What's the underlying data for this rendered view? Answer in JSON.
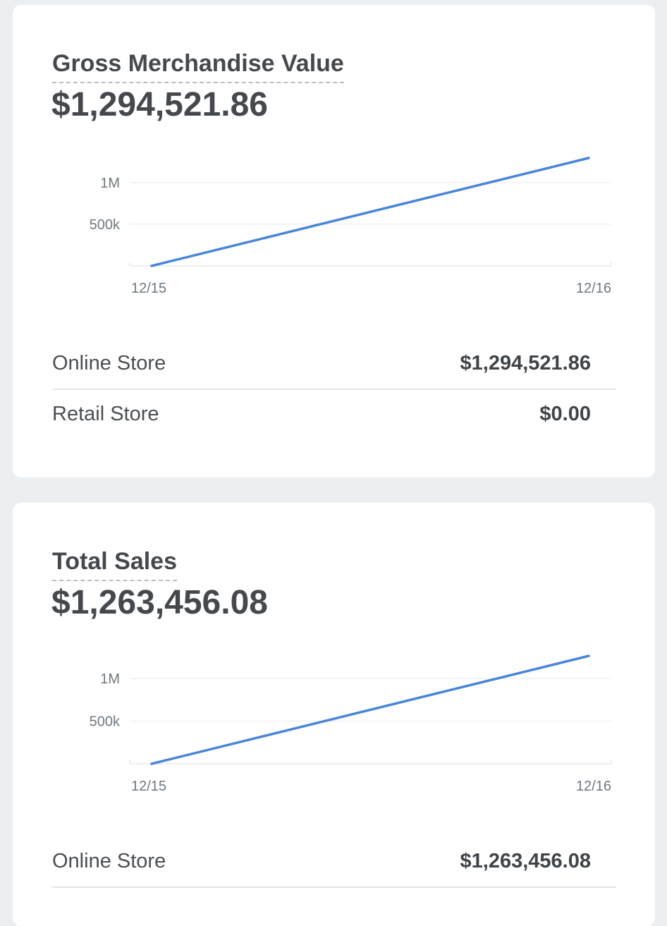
{
  "cards": [
    {
      "title": "Gross Merchandise Value",
      "value": "$1,294,521.86",
      "chart_data": {
        "type": "line",
        "x": [
          "12/15",
          "12/16"
        ],
        "series": [
          {
            "values": [
              0,
              1294521.86
            ]
          }
        ],
        "y_ticks": [
          {
            "value": 500000,
            "label": "500k"
          },
          {
            "value": 1000000,
            "label": "1M"
          }
        ],
        "ylim": [
          0,
          1294521.86
        ],
        "color": "#4a86d8",
        "grid": true
      },
      "rows": [
        {
          "label": "Online Store",
          "value": "$1,294,521.86"
        },
        {
          "label": "Retail Store",
          "value": "$0.00"
        }
      ]
    },
    {
      "title": "Total Sales",
      "value": "$1,263,456.08",
      "chart_data": {
        "type": "line",
        "x": [
          "12/15",
          "12/16"
        ],
        "series": [
          {
            "values": [
              0,
              1263456.08
            ]
          }
        ],
        "y_ticks": [
          {
            "value": 500000,
            "label": "500k"
          },
          {
            "value": 1000000,
            "label": "1M"
          }
        ],
        "ylim": [
          0,
          1263456.08
        ],
        "color": "#4a86d8",
        "grid": true
      },
      "rows": [
        {
          "label": "Online Store",
          "value": "$1,263,456.08"
        }
      ]
    }
  ]
}
